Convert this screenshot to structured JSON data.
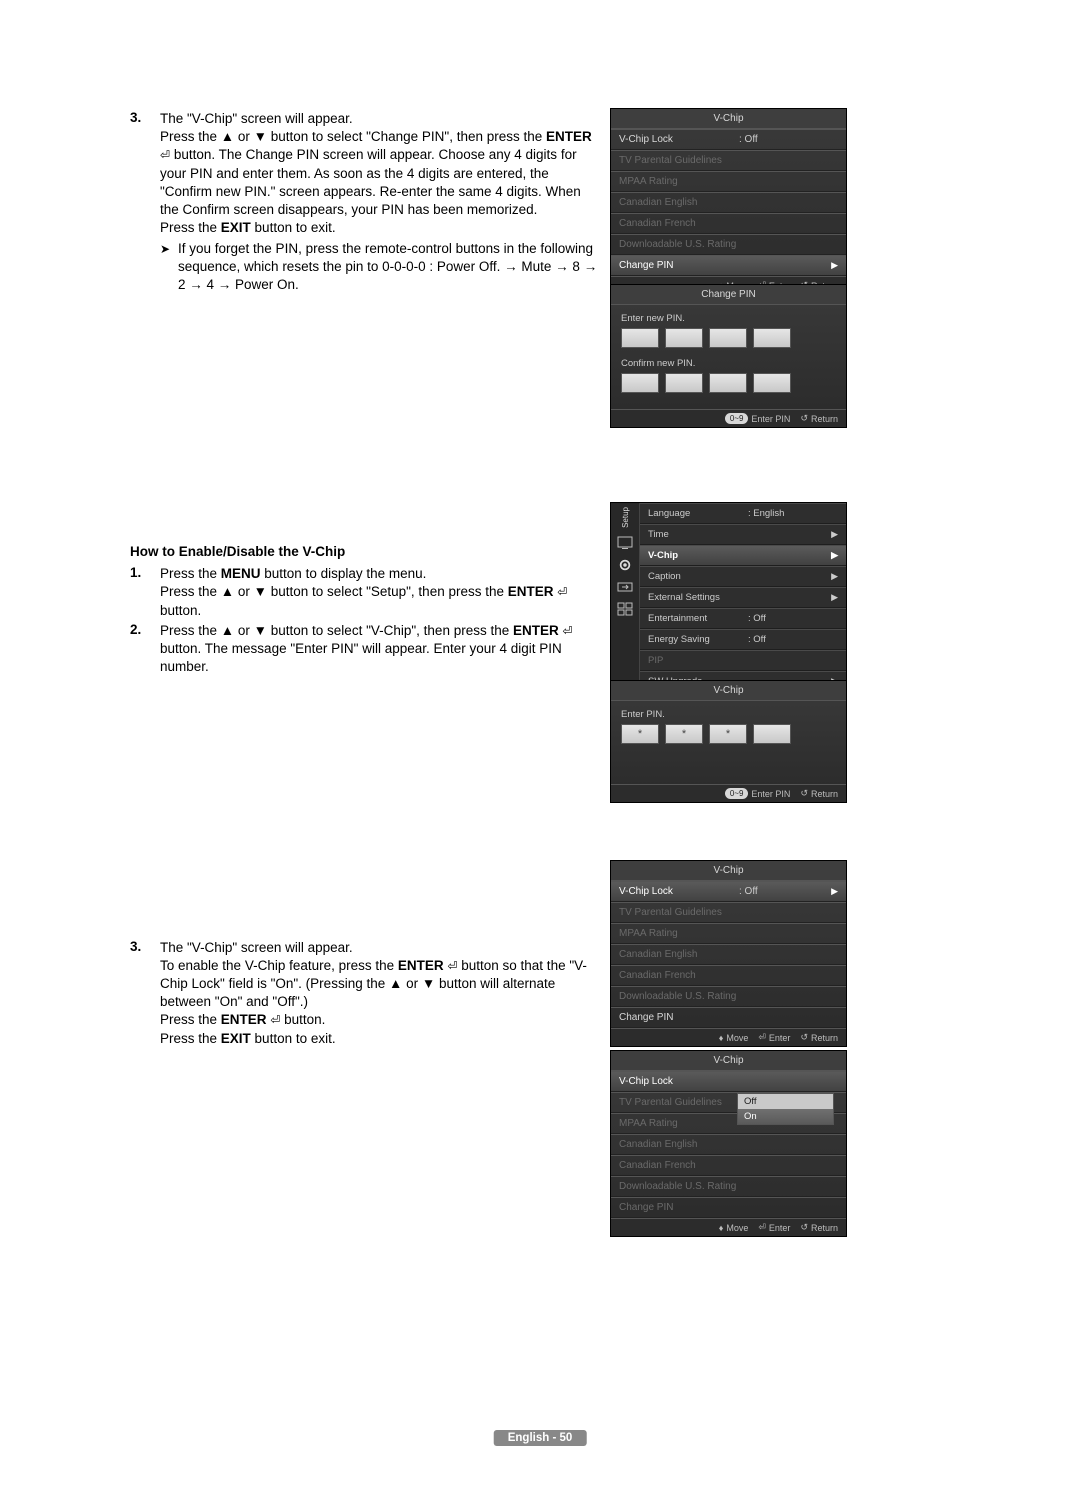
{
  "step3top": {
    "num": "3.",
    "line1": "The \"V-Chip\" screen will appear.",
    "line2a": "Press the ▲ or ▼ button to select \"Change PIN\", then press the ",
    "line2_bold": "ENTER",
    "line2b": " button. The Change PIN screen will appear. Choose any 4 digits for your PIN and enter them. As soon as the 4 digits are entered, the \"Confirm new PIN.\" screen appears. Re-enter the same 4 digits. When the Confirm screen disappears, your PIN has been memorized.",
    "exit_a": "Press the ",
    "exit_b": "EXIT",
    "exit_c": " button to exit.",
    "note": "If you forget the PIN, press the remote-control buttons in the following sequence, which resets the pin to 0-0-0-0 : Power Off. → Mute → 8 → 2 → 4 → Power On."
  },
  "section_title": "How to Enable/Disable the V-Chip",
  "step1": {
    "num": "1.",
    "a": "Press the ",
    "menu": "MENU",
    "b": " button to display the menu.",
    "c": "Press the ▲ or ▼ button to select \"Setup\", then press the ",
    "enter": "ENTER",
    "d": " button."
  },
  "step2": {
    "num": "2.",
    "a": "Press the ▲ or ▼ button to select \"V-Chip\", then press the ",
    "enter": "ENTER",
    "b": " button. The message \"Enter PIN\" will appear. Enter your 4 digit PIN number."
  },
  "step3": {
    "num": "3.",
    "a": "The \"V-Chip\" screen will appear.",
    "b1": "To enable the V-Chip feature, press the ",
    "enter1": "ENTER",
    "b2": " button so that the \"V-Chip Lock\" field is \"On\". (Pressing the ▲ or ▼ button will alternate between \"On\" and \"Off\".)",
    "c1": "Press the ",
    "enter2": "ENTER",
    "c2": " button.",
    "d1": "Press the ",
    "exit": "EXIT",
    "d2": " button to exit."
  },
  "osd_vchip": {
    "title": "V-Chip",
    "rows": [
      {
        "lab": "V-Chip Lock",
        "val": ": Off",
        "dim": false,
        "sel": false
      },
      {
        "lab": "TV Parental Guidelines",
        "val": "",
        "dim": true
      },
      {
        "lab": "MPAA Rating",
        "val": "",
        "dim": true
      },
      {
        "lab": "Canadian English",
        "val": "",
        "dim": true
      },
      {
        "lab": "Canadian French",
        "val": "",
        "dim": true
      },
      {
        "lab": "Downloadable U.S. Rating",
        "val": "",
        "dim": true
      },
      {
        "lab": "Change PIN",
        "val": "",
        "dim": false,
        "sel": true,
        "tri": "▶"
      }
    ],
    "footer": {
      "move": "Move",
      "enter": "Enter",
      "ret": "Return"
    }
  },
  "osd_changepin": {
    "title": "Change PIN",
    "enter_label": "Enter new PIN.",
    "confirm_label": "Confirm new PIN.",
    "footer_badge": "0~9",
    "footer_enter": "Enter PIN",
    "footer_ret": "Return"
  },
  "osd_setup": {
    "vlabel": "Setup",
    "rows": [
      {
        "lab": "Language",
        "val": ": English"
      },
      {
        "lab": "Time",
        "val": "",
        "tri": "▶"
      },
      {
        "lab": "V-Chip",
        "val": "",
        "sel": true,
        "tri": "▶"
      },
      {
        "lab": "Caption",
        "val": "",
        "tri": "▶"
      },
      {
        "lab": "External Settings",
        "val": "",
        "tri": "▶"
      },
      {
        "lab": "Entertainment",
        "val": ": Off"
      },
      {
        "lab": "Energy Saving",
        "val": ": Off"
      },
      {
        "lab": "PIP",
        "val": "",
        "dim": true
      },
      {
        "lab": "SW Upgrade",
        "val": "",
        "tri": "▶"
      }
    ]
  },
  "osd_enterpin": {
    "title": "V-Chip",
    "label": "Enter PIN.",
    "footer_badge": "0~9",
    "footer_enter": "Enter PIN",
    "footer_ret": "Return"
  },
  "osd_vchip2": {
    "title": "V-Chip",
    "rows": [
      {
        "lab": "V-Chip Lock",
        "val": ": Off",
        "sel": true,
        "tri": "▶"
      },
      {
        "lab": "TV Parental Guidelines",
        "val": "",
        "dim": true
      },
      {
        "lab": "MPAA Rating",
        "val": "",
        "dim": true
      },
      {
        "lab": "Canadian English",
        "val": "",
        "dim": true
      },
      {
        "lab": "Canadian French",
        "val": "",
        "dim": true
      },
      {
        "lab": "Downloadable U.S. Rating",
        "val": "",
        "dim": true
      },
      {
        "lab": "Change PIN",
        "val": ""
      }
    ],
    "footer": {
      "move": "Move",
      "enter": "Enter",
      "ret": "Return"
    }
  },
  "osd_vchip3": {
    "title": "V-Chip",
    "rows": [
      {
        "lab": "V-Chip Lock",
        "val": "",
        "sel": true
      },
      {
        "lab": "TV Parental Guidelines",
        "val": "",
        "dim": true
      },
      {
        "lab": "MPAA Rating",
        "val": "",
        "dim": true
      },
      {
        "lab": "Canadian English",
        "val": "",
        "dim": true
      },
      {
        "lab": "Canadian French",
        "val": "",
        "dim": true
      },
      {
        "lab": "Downloadable U.S. Rating",
        "val": "",
        "dim": true
      },
      {
        "lab": "Change PIN",
        "val": "",
        "dim": true
      }
    ],
    "dropdown": {
      "off": "Off",
      "on": "On"
    },
    "footer": {
      "move": "Move",
      "enter": "Enter",
      "ret": "Return"
    }
  },
  "pagenum": "English - 50"
}
